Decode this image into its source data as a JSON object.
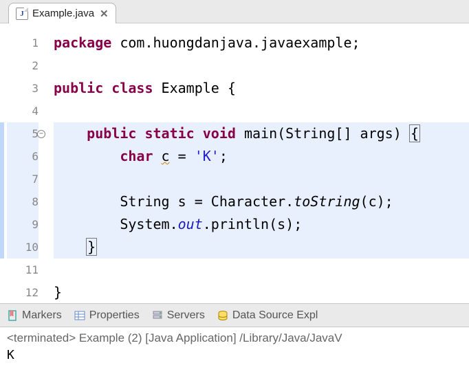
{
  "tab": {
    "icon_letter": "J",
    "filename": "Example.java"
  },
  "gutter": {
    "lines": [
      "1",
      "2",
      "3",
      "4",
      "5",
      "6",
      "7",
      "8",
      "9",
      "10",
      "11",
      "12"
    ],
    "highlighted": [
      5,
      6,
      7,
      8,
      9,
      10
    ],
    "fold_at": 5
  },
  "code": {
    "l1": {
      "kw1": "package",
      "rest": " com.huongdanjava.javaexample;"
    },
    "l3": {
      "kw1": "public",
      "kw2": "class",
      "name": " Example {"
    },
    "l5": {
      "indent": "    ",
      "kw1": "public",
      "kw2": "static",
      "kw3": "void",
      "rest1": " main(String[] args) ",
      "brace": "{"
    },
    "l6": {
      "indent": "        ",
      "kw1": "char",
      "rest1": " ",
      "onecap": "c",
      "rest2": " = ",
      "str": "'K'",
      "semi": ";"
    },
    "l8": {
      "indent": "        ",
      "rest1": "String s = Character.",
      "method": "toString",
      "rest2": "(c);"
    },
    "l9": {
      "indent": "        ",
      "rest1": "System.",
      "field": "out",
      "rest2": ".println(s);"
    },
    "l10": {
      "indent": "    ",
      "brace": "}"
    },
    "l12": {
      "brace": "}"
    }
  },
  "bottom_tabs": {
    "markers": "Markers",
    "properties": "Properties",
    "servers": "Servers",
    "dse": "Data Source Expl"
  },
  "console": {
    "header": "<terminated> Example (2) [Java Application] /Library/Java/JavaV",
    "output": "K"
  }
}
